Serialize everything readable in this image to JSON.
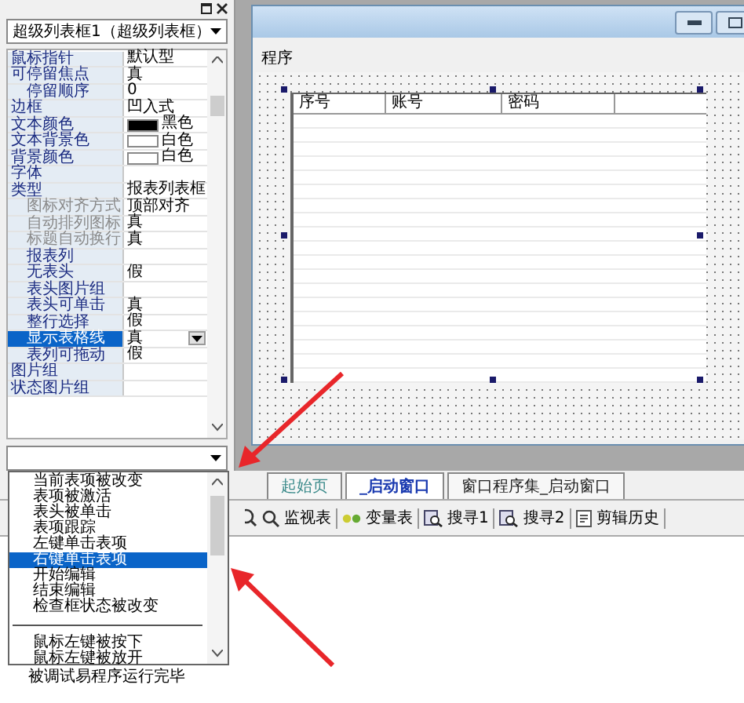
{
  "panel": {
    "object_selector": "超级列表框1（超级列表框）",
    "properties": [
      {
        "name": "鼠标指针",
        "value": "默认型",
        "selected": false,
        "disabled": false
      },
      {
        "name": "可停留焦点",
        "value": "真",
        "selected": false,
        "disabled": false,
        "children": [
          {
            "name": "停留顺序",
            "value": "0",
            "selected": false,
            "disabled": false
          }
        ]
      },
      {
        "name": "边框",
        "value": "凹入式",
        "selected": false,
        "disabled": false
      },
      {
        "name": "文本颜色",
        "value": "黑色",
        "color": "#000000",
        "selected": false,
        "disabled": false
      },
      {
        "name": "文本背景色",
        "value": "白色",
        "color": "#ffffff",
        "selected": false,
        "disabled": false
      },
      {
        "name": "背景颜色",
        "value": "白色",
        "color": "#ffffff",
        "selected": false,
        "disabled": false
      },
      {
        "name": "字体",
        "selected": false,
        "disabled": false
      },
      {
        "name": "类型",
        "value": "报表列表框",
        "selected": false,
        "disabled": false,
        "children": [
          {
            "name": "图标对齐方式",
            "value": "顶部对齐",
            "selected": false,
            "disabled": true
          },
          {
            "name": "自动排列图标",
            "value": "真",
            "selected": false,
            "disabled": true
          },
          {
            "name": "标题自动换行",
            "value": "真",
            "selected": false,
            "disabled": true
          },
          {
            "name": "报表列",
            "selected": false,
            "disabled": false
          },
          {
            "name": "无表头",
            "value": "假",
            "selected": false,
            "disabled": false
          },
          {
            "name": "表头图片组",
            "selected": false,
            "disabled": false
          },
          {
            "name": "表头可单击",
            "value": "真",
            "selected": false,
            "disabled": false
          },
          {
            "name": "整行选择",
            "value": "假",
            "selected": false,
            "disabled": false
          },
          {
            "name": "显示表格线",
            "value": "真",
            "selected": true,
            "disabled": false
          },
          {
            "name": "表列可拖动",
            "value": "假",
            "selected": false,
            "disabled": false
          }
        ]
      },
      {
        "name": "图片组",
        "selected": false,
        "disabled": false
      },
      {
        "name": "状态图片组",
        "selected": false,
        "disabled": false
      }
    ],
    "event_list": [
      {
        "kind": "item",
        "label": "当前表项被改变",
        "selected": false
      },
      {
        "kind": "item",
        "label": "表项被激活",
        "selected": false
      },
      {
        "kind": "item",
        "label": "表头被单击",
        "selected": false
      },
      {
        "kind": "item",
        "label": "表项跟踪",
        "selected": false
      },
      {
        "kind": "item",
        "label": "左键单击表项",
        "selected": false
      },
      {
        "kind": "item",
        "label": "右键单击表项",
        "selected": true
      },
      {
        "kind": "item",
        "label": "开始编辑",
        "selected": false
      },
      {
        "kind": "item",
        "label": "结束编辑",
        "selected": false
      },
      {
        "kind": "item",
        "label": "检查框状态被改变",
        "selected": false
      },
      {
        "kind": "separator"
      },
      {
        "kind": "item",
        "label": "鼠标左键被按下",
        "selected": false
      },
      {
        "kind": "item",
        "label": "鼠标左键被放开",
        "selected": false
      }
    ]
  },
  "designer": {
    "label": "程序",
    "columns": [
      "序号",
      "账号",
      "密码"
    ]
  },
  "tabs": [
    {
      "label": "起始页",
      "selected": false
    },
    {
      "label": "_启动窗口",
      "selected": true
    },
    {
      "label": "窗口程序集_启动窗口",
      "selected": false
    }
  ],
  "toolbar": [
    {
      "kind": "watch",
      "label": "监视表"
    },
    {
      "kind": "variables",
      "label": "变量表"
    },
    {
      "kind": "search",
      "label": "搜寻1"
    },
    {
      "kind": "search",
      "label": "搜寻2"
    },
    {
      "kind": "history",
      "label": "剪辑历史"
    }
  ],
  "output": {
    "text": "被调试易程序运行完毕"
  }
}
